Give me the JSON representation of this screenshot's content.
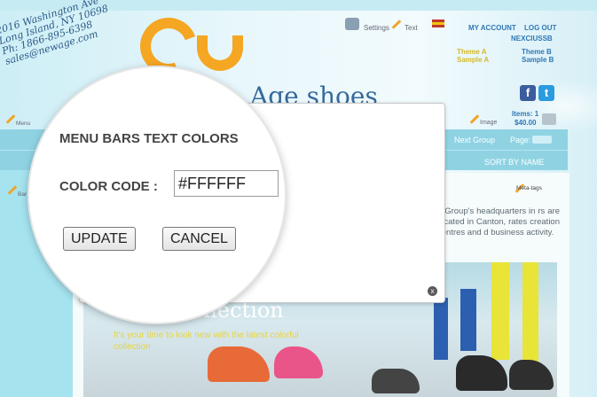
{
  "header": {
    "settings_label": "Settings",
    "text_label": "Text",
    "my_account": "MY ACCOUNT",
    "log_out": "LOG OUT",
    "username": "NEXCIUSSB",
    "theme_a_line1": "Theme A",
    "theme_a_line2": "Sample A",
    "theme_b_line1": "Theme B",
    "theme_b_line2": "Sample B",
    "image_label": "Image",
    "items_label": "Items: 1",
    "cart_total": "$40.00",
    "menu_label": "Menu"
  },
  "address": {
    "line1": "2016 Washington Ave",
    "line2": "Long Island, NY 10698",
    "line3": "Ph: 1866-895-6398",
    "line4": "sales@newage.com"
  },
  "logo": {
    "site_name": "Age shoes"
  },
  "social": {
    "facebook": "f",
    "twitter": "t"
  },
  "menubar": {
    "next_group": "Next Group",
    "page_label": "Page:",
    "sort_by": "SORT BY  NAME",
    "bar_set_label": "Bar Se"
  },
  "content": {
    "meta_tags_label": "Meta-tags",
    "paragraph": "e Group's headquarters in rs are located in Canton, rates creation centres and d business activity.",
    "banner_title": "2012 Collection",
    "banner_tagline": "It's your time to look new with the latest colorful collection"
  },
  "modal": {
    "title": "MENU BARS TEXT COLORS",
    "color_code_label": "COLOR CODE :",
    "color_code_value": "#FFFFFF",
    "update_button": "UPDATE",
    "cancel_button": "CANCEL",
    "close_symbol": "x"
  },
  "colors": {
    "accent_orange": "#f5a623",
    "link_blue": "#2f78b7",
    "menubar_bg": "#8fd3e3"
  }
}
